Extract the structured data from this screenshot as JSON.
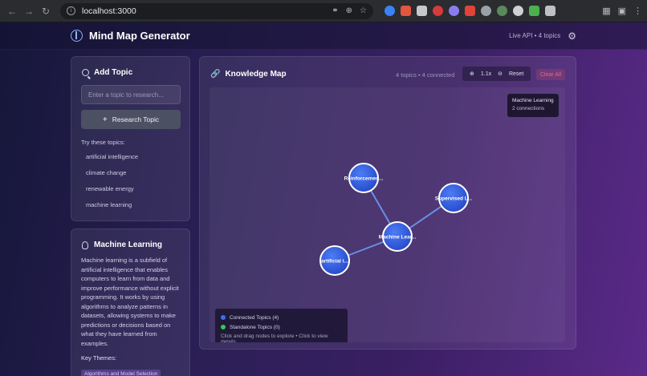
{
  "browser": {
    "url": "localhost:3000"
  },
  "header": {
    "title": "Mind Map Generator",
    "status": "Live API • 4 topics"
  },
  "add_topic": {
    "title": "Add Topic",
    "input_placeholder": "Enter a topic to research...",
    "button_label": "Research Topic",
    "button_icon": "+",
    "try_label": "Try these topics:",
    "suggestions": [
      "artificial intelligence",
      "climate change",
      "renewable energy",
      "machine learning"
    ]
  },
  "detail": {
    "title": "Machine Learning",
    "description": "Machine learning is a subfield of artificial intelligence that enables computers to learn from data and improve performance without explicit programming. It works by using algorithms to analyze patterns in datasets, allowing systems to make predictions or decisions based on what they have learned from examples.",
    "themes_label": "Key Themes:",
    "themes": [
      "Algorithms and Model Selection"
    ]
  },
  "map": {
    "title": "Knowledge Map",
    "stats": "4 topics • 4 connected",
    "zoom_level": "1.1x",
    "reset_label": "Reset",
    "clear_label": "Clear All",
    "tooltip": {
      "title": "Machine Learning",
      "subtitle": "2 connections"
    },
    "nodes": [
      {
        "label": "Reinforcemen..."
      },
      {
        "label": "Supervised L..."
      },
      {
        "label": "Machine Lear..."
      },
      {
        "label": "artificial i..."
      }
    ],
    "legend": {
      "connected": "Connected Topics (4)",
      "standalone": "Standalone Topics (0)",
      "hint": "Click and drag nodes to explore • Click to view details"
    }
  },
  "colors": {
    "connected": "#3b6ef0",
    "standalone": "#34c759",
    "accent": "#8ab4ff",
    "danger": "#e36b84"
  }
}
